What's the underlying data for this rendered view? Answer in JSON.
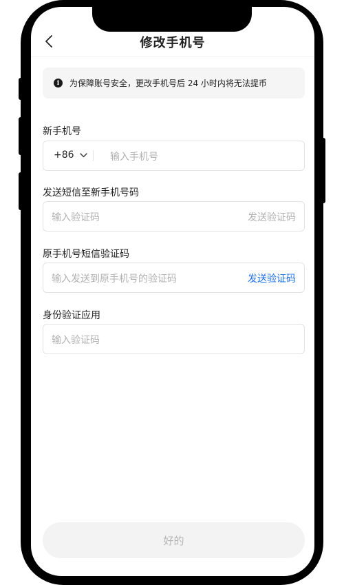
{
  "header": {
    "title": "修改手机号",
    "back_icon": "chevron-left-icon"
  },
  "notice": {
    "icon": "info-icon",
    "icon_glyph": "i",
    "text": "为保障账号安全，更改手机号后 24 小时内将无法提币"
  },
  "new_phone": {
    "label": "新手机号",
    "country_code": "+86",
    "placeholder": "输入手机号"
  },
  "new_phone_sms": {
    "label": "发送短信至新手机号码",
    "placeholder": "输入验证码",
    "send_label": "发送验证码"
  },
  "old_phone_sms": {
    "label": "原手机号短信验证码",
    "placeholder": "输入发送到原手机号的验证码",
    "send_label": "发送验证码"
  },
  "authenticator": {
    "label": "身份验证应用",
    "placeholder": "输入验证码"
  },
  "confirm": {
    "label": "好的"
  },
  "colors": {
    "link": "#1d6fe0",
    "disabled_text": "#b0b0b0",
    "button_bg": "#f3f3f3"
  }
}
